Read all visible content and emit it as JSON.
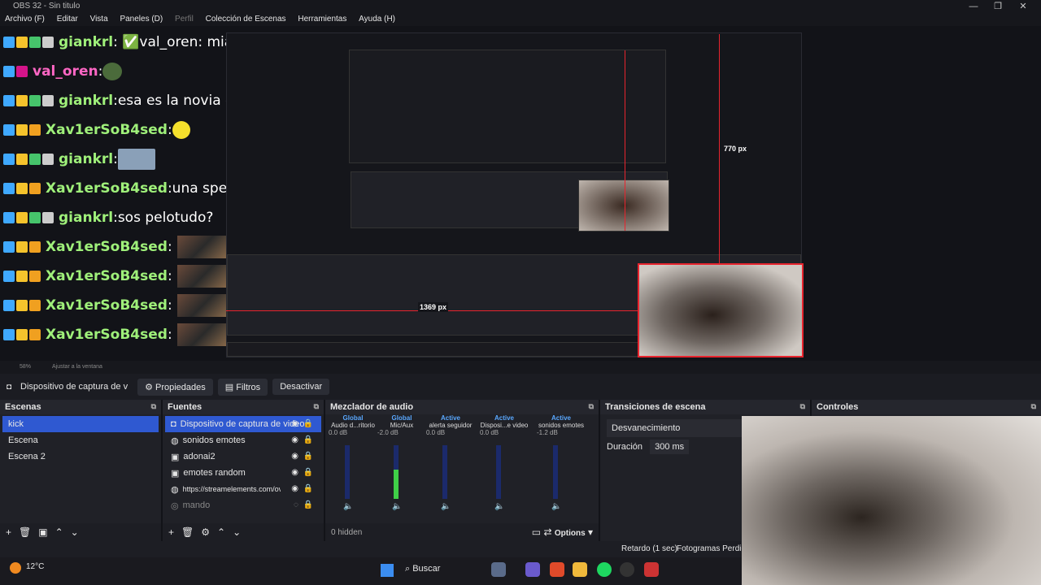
{
  "window": {
    "title": "OBS 32 - Sin titulo",
    "min_icon": "minimize-icon",
    "max_icon": "maximize-icon",
    "close_icon": "close-icon"
  },
  "menu": [
    "Archivo (F)",
    "Editar",
    "Vista",
    "Paneles (D)",
    "Perfil",
    "Colección de Escenas",
    "Herramientas",
    "Ayuda (H)"
  ],
  "chat": [
    {
      "user": "giankrl",
      "msg": "val_oren: miamooooo",
      "user_color": "#9ff07a"
    },
    {
      "user": "val_oren",
      "msg": "",
      "user_color": "#ff66c4"
    },
    {
      "user": "giankrl",
      "msg": "esa es la novia de nanoide?",
      "user_color": "#9ff07a"
    },
    {
      "user": "Xav1erSoB4sed",
      "msg": "",
      "user_color": "#9ff07a"
    },
    {
      "user": "giankrl",
      "msg": "",
      "user_color": "#9ff07a"
    },
    {
      "user": "Xav1erSoB4sed",
      "msg": "una speed",
      "user_color": "#9ff07a"
    },
    {
      "user": "giankrl",
      "msg": "sos pelotudo?",
      "user_color": "#9ff07a"
    },
    {
      "user": "Xav1erSoB4sed",
      "msg": "",
      "user_color": "#9ff07a"
    },
    {
      "user": "Xav1erSoB4sed",
      "msg": "",
      "user_color": "#9ff07a"
    },
    {
      "user": "Xav1erSoB4sed",
      "msg": "",
      "user_color": "#9ff07a"
    },
    {
      "user": "Xav1erSoB4sed",
      "msg": "",
      "user_color": "#9ff07a"
    }
  ],
  "preview": {
    "height_label": "770 px",
    "width_label": "1369 px",
    "zoom": "58%",
    "fit": "Ajustar a la ventana"
  },
  "source_toolbar": {
    "source": "Dispositivo de captura de v",
    "properties": "Propiedades",
    "filters": "Filtros",
    "deactivate": "Desactivar"
  },
  "scenes": {
    "title": "Escenas",
    "items": [
      "kick",
      "Escena",
      "Escena 2"
    ]
  },
  "sources": {
    "title": "Fuentes",
    "items": [
      "Dispositivo de captura de video",
      "sonidos emotes",
      "adonai2",
      "emotes random",
      "https://streamelements.com/ov",
      "mando",
      "..."
    ]
  },
  "mixer": {
    "title": "Mezclador de audio",
    "channels": [
      {
        "status": "Global",
        "name": "Audio d...ritorio",
        "db": "0.0 dB",
        "level": 0.0
      },
      {
        "status": "Global",
        "name": "Mic/Aux",
        "db": "-2.0 dB",
        "level": 0.55
      },
      {
        "status": "Active",
        "name": "alerta seguidor",
        "db": "0.0 dB",
        "level": 0.0
      },
      {
        "status": "Active",
        "name": "Disposi...e video",
        "db": "0.0 dB",
        "level": 0.0
      },
      {
        "status": "Active",
        "name": "sonidos emotes",
        "db": "-1.2 dB",
        "level": 0.0
      }
    ],
    "hidden": "0 hidden",
    "options": "Options"
  },
  "transitions": {
    "title": "Transiciones de escena",
    "selected": "Desvanecimiento",
    "duration_label": "Duración",
    "duration": "300 ms"
  },
  "controls": {
    "title": "Controles"
  },
  "status": {
    "delay": "Retardo (1 sec)",
    "frames": "Fotogramas Perdidos"
  },
  "taskbar": {
    "weather": "12°C",
    "search": "Buscar"
  }
}
